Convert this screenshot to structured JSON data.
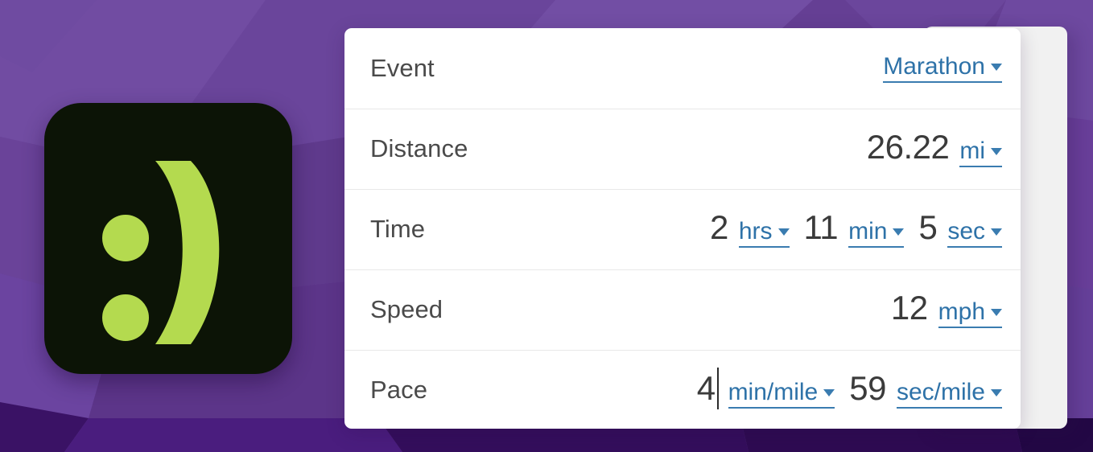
{
  "app": {
    "logo_alt": "smiley-face-logo",
    "logo_background": "#0C1406",
    "logo_accent": "#B4DA4F",
    "background_purple": "#6C479C",
    "background_purple_dark": "#2E0B52",
    "link_color": "#2E72A8",
    "value_color": "#3B3B3B",
    "label_color": "#4A4A4A",
    "card_background": "#FFFFFF",
    "behind_panel_color": "#F1F1F1"
  },
  "card": {
    "rows": [
      {
        "label": "Event",
        "fields": [
          {
            "kind": "unit",
            "unit": "Marathon"
          }
        ]
      },
      {
        "label": "Distance",
        "fields": [
          {
            "kind": "value",
            "value": "26.22"
          },
          {
            "kind": "unit",
            "unit": "mi"
          }
        ]
      },
      {
        "label": "Time",
        "fields": [
          {
            "kind": "value",
            "value": "2"
          },
          {
            "kind": "unit",
            "unit": "hrs"
          },
          {
            "kind": "value",
            "value": "11"
          },
          {
            "kind": "unit",
            "unit": "min"
          },
          {
            "kind": "value",
            "value": "5"
          },
          {
            "kind": "unit",
            "unit": "sec"
          }
        ]
      },
      {
        "label": "Speed",
        "fields": [
          {
            "kind": "value",
            "value": "12"
          },
          {
            "kind": "unit",
            "unit": "mph"
          }
        ]
      },
      {
        "label": "Pace",
        "fields": [
          {
            "kind": "value",
            "value": "4",
            "caret": true
          },
          {
            "kind": "unit",
            "unit": "min/mile"
          },
          {
            "kind": "value",
            "value": "59"
          },
          {
            "kind": "unit",
            "unit": "sec/mile"
          }
        ]
      }
    ]
  },
  "rows_flat": {
    "event": {
      "label": "Event",
      "event_unit": "Marathon"
    },
    "distance": {
      "label": "Distance",
      "value": "26.22",
      "unit": "mi"
    },
    "time": {
      "label": "Time",
      "hours": "2",
      "hours_unit": "hrs",
      "minutes": "11",
      "minutes_unit": "min",
      "seconds": "5",
      "seconds_unit": "sec"
    },
    "speed": {
      "label": "Speed",
      "value": "12",
      "unit": "mph"
    },
    "pace": {
      "label": "Pace",
      "minutes": "4",
      "minutes_unit": "min/mile",
      "seconds": "59",
      "seconds_unit": "sec/mile"
    }
  }
}
